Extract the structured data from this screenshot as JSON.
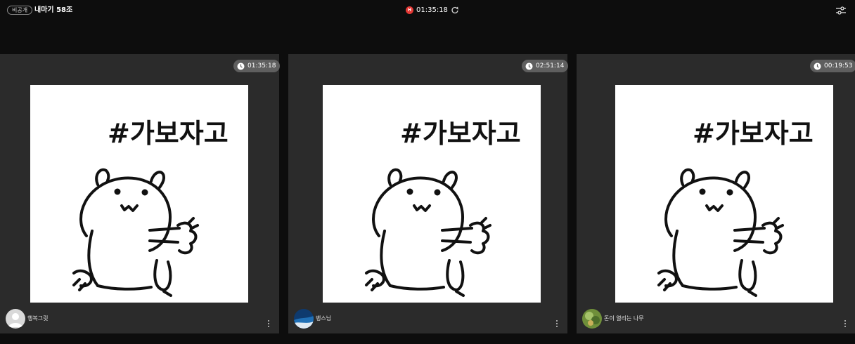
{
  "header": {
    "privacy_label": "비공개",
    "room_title": "내마기 58조",
    "rec_label": "H",
    "timer": "01:35:18"
  },
  "tiles": [
    {
      "timer": "01:35:18",
      "name": "행복그릿",
      "overlay_text": "#가보자고"
    },
    {
      "timer": "02:51:14",
      "name": "뱅스님",
      "overlay_text": "#가보자고"
    },
    {
      "timer": "00:19:53",
      "name": "돈이 열리는 나무",
      "overlay_text": "#가보자고"
    }
  ],
  "colors": {
    "background": "#0d0d0d",
    "tile": "#2b2b2b",
    "badge": "#5f5f5f",
    "record": "#e53935"
  },
  "icons": [
    "refresh-icon",
    "settings-icon",
    "clock-icon",
    "more-vert-icon"
  ]
}
